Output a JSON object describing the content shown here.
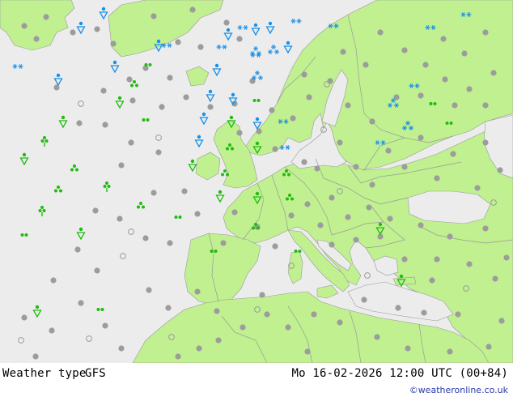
{
  "footer": {
    "product_label": "Weather type",
    "model": "GFS",
    "valid_time": "Mo 16-02-2026 12:00 UTC (00+84)",
    "brand": "©weatheronline.co.uk"
  },
  "colors": {
    "sea": "#ececec",
    "land": "#c0f090",
    "border": "#9a9a9a",
    "cloud_symbol": "#9c9c9c",
    "rain_symbol": "#22bb11",
    "snow_symbol": "#1a90e8",
    "brand_text": "#2a3aa8"
  },
  "legend_symbols": [
    "cloud-dot",
    "rain-drops",
    "showers",
    "snow-flakes",
    "snow-showers",
    "open-circle"
  ]
}
